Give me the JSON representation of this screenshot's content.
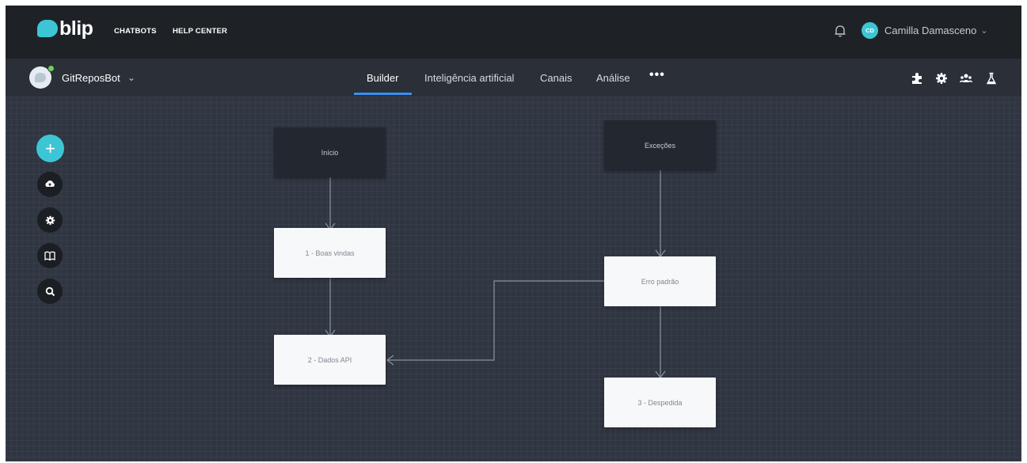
{
  "header": {
    "logo_text": "blip",
    "nav": [
      "CHATBOTS",
      "HELP CENTER"
    ],
    "user": {
      "initials": "CD",
      "name": "Camilla Damasceno"
    }
  },
  "subbar": {
    "bot_name": "GitReposBot",
    "tabs": [
      {
        "label": "Builder",
        "active": true
      },
      {
        "label": "Inteligência artificial",
        "active": false
      },
      {
        "label": "Canais",
        "active": false
      },
      {
        "label": "Análise",
        "active": false
      }
    ],
    "more_label": "•••",
    "right_icons": [
      "extensions-icon",
      "settings-icon",
      "team-icon",
      "lab-icon"
    ]
  },
  "toolbar": {
    "add_label": "+",
    "tools": [
      "upload-icon",
      "settings-icon",
      "book-icon",
      "search-icon"
    ]
  },
  "flow": {
    "nodes": [
      {
        "id": "inicio",
        "label": "Início",
        "style": "dark"
      },
      {
        "id": "excecoes",
        "label": "Exceções",
        "style": "dark"
      },
      {
        "id": "boas_vindas",
        "label": "1 - Boas vindas",
        "style": "light"
      },
      {
        "id": "erro_padrao",
        "label": "Erro padrão",
        "style": "light"
      },
      {
        "id": "dados_api",
        "label": "2 - Dados API",
        "style": "light"
      },
      {
        "id": "despedida",
        "label": "3 - Despedida",
        "style": "light"
      }
    ],
    "connections": [
      [
        "inicio",
        "boas_vindas"
      ],
      [
        "boas_vindas",
        "dados_api"
      ],
      [
        "excecoes",
        "erro_padrao"
      ],
      [
        "erro_padrao",
        "dados_api"
      ],
      [
        "erro_padrao",
        "despedida"
      ]
    ]
  },
  "colors": {
    "accent": "#3cc6d5",
    "tab_underline": "#3a8ef0",
    "canvas": "#2f3541"
  }
}
